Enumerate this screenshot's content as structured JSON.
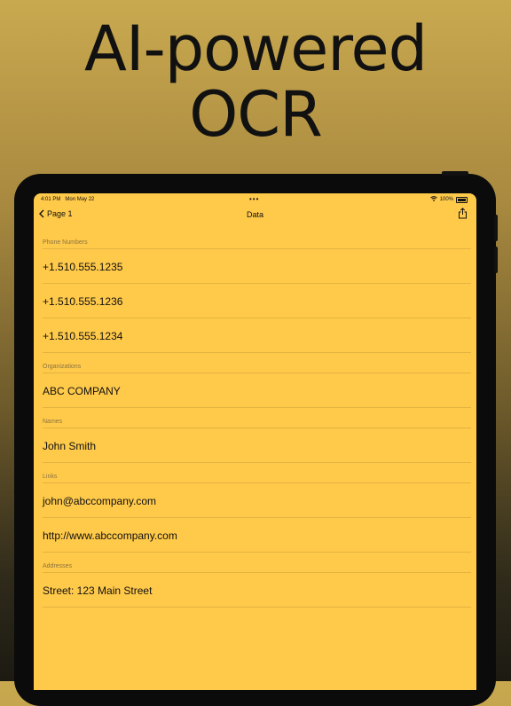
{
  "headline": {
    "line1": "AI-powered",
    "line2": "OCR"
  },
  "status_bar": {
    "time": "4:01 PM",
    "date": "Mon May 22",
    "battery": "100%"
  },
  "nav": {
    "back_label": "Page 1",
    "title": "Data"
  },
  "sections": [
    {
      "header": "Phone Numbers",
      "rows": [
        "+1.510.555.1235",
        "+1.510.555.1236",
        "+1.510.555.1234"
      ]
    },
    {
      "header": "Organizations",
      "rows": [
        "ABC COMPANY"
      ]
    },
    {
      "header": "Names",
      "rows": [
        "John Smith"
      ]
    },
    {
      "header": "Links",
      "rows": [
        "john@abccompany.com",
        "http://www.abccompany.com"
      ]
    },
    {
      "header": "Addresses",
      "rows": [
        "Street: 123 Main Street"
      ]
    }
  ],
  "colors": {
    "screen_bg": "#ffc94a",
    "separator": "#e3b440",
    "device_frame": "#0b0b0b"
  }
}
